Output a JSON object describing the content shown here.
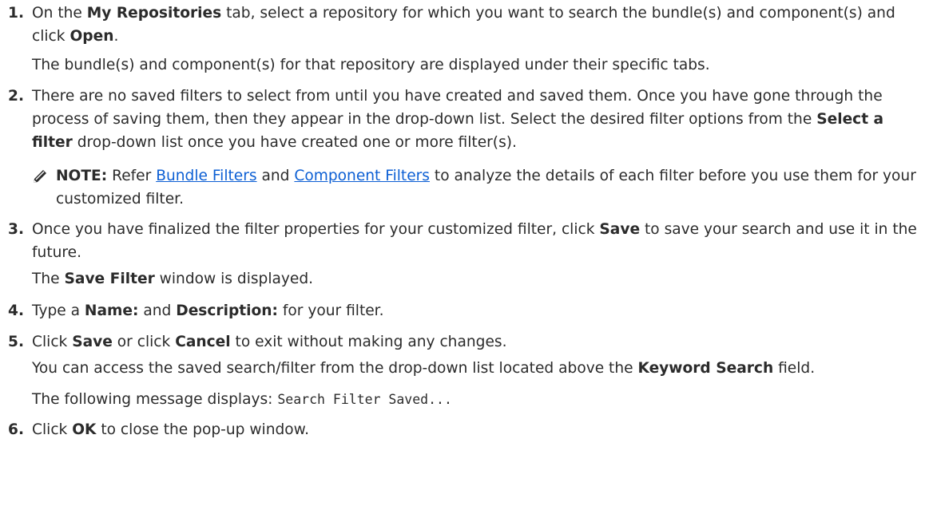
{
  "steps": [
    {
      "num": "1.",
      "t1a": "On the ",
      "t1b": "My Repositories",
      "t1c": " tab, select a repository for which you want to search the bundle(s) and component(s) and click ",
      "t1d": "Open",
      "t1e": ".",
      "sub": "The bundle(s) and component(s) for that repository are displayed under their specific tabs."
    },
    {
      "num": "2.",
      "t1a": "There are no saved filters to select from until you have created and saved them. Once you have gone through the process of saving them, then they appear in the drop-down list. Select the desired filter options from the ",
      "t1b": "Select a filter",
      "t1c": " drop-down list once you have created one or more filter(s).",
      "note": {
        "icon": "pencil-icon",
        "label": "NOTE:",
        "pre": " Refer ",
        "link1": "Bundle Filters",
        "mid": " and ",
        "link2": "Component Filters",
        "post": " to analyze the details of each filter before you use them for your customized filter."
      }
    },
    {
      "num": "3.",
      "t1a": "Once you have finalized the filter properties for your customized filter, click ",
      "t1b": "Save",
      "t1c": " to save your search and use it in the future.",
      "sub_a": "The ",
      "sub_b": "Save Filter",
      "sub_c": " window is displayed."
    },
    {
      "num": "4.",
      "t1a": "Type a ",
      "t1b": "Name:",
      "t1c": " and ",
      "t1d": "Description:",
      "t1e": " for your filter."
    },
    {
      "num": "5.",
      "t1a": "Click ",
      "t1b": "Save",
      "t1c": " or click ",
      "t1d": "Cancel",
      "t1e": " to exit without making any changes.",
      "sub1_a": "You can access the saved search/filter from the drop-down list located above the ",
      "sub1_b": "Keyword Search",
      "sub1_c": " field.",
      "sub2_a": "The following message displays: ",
      "sub2_code": "Search Filter Saved..."
    },
    {
      "num": "6.",
      "t1a": "Click ",
      "t1b": "OK",
      "t1c": " to close the pop-up window."
    }
  ],
  "colors": {
    "text": "#2b2b2b",
    "link": "#0c5fd4"
  }
}
